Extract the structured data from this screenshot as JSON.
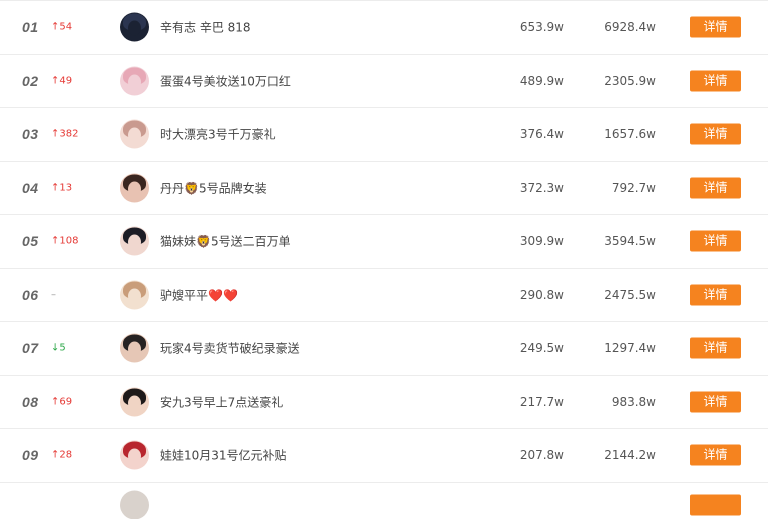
{
  "colors": {
    "accent": "#f5831f",
    "up": "#e53935",
    "down": "#2ea84a",
    "row_border": "#ececec"
  },
  "rows": [
    {
      "rank": "01",
      "trend": "↑54",
      "trend_dir": "up",
      "name": "辛有志 辛巴 818",
      "v1": "653.9w",
      "v2": "6928.4w",
      "btn": "详情",
      "avatar": [
        "#1b2233",
        "#2b3550"
      ]
    },
    {
      "rank": "02",
      "trend": "↑49",
      "trend_dir": "up",
      "name": "蛋蛋4号美妆送10万口红",
      "v1": "489.9w",
      "v2": "2305.9w",
      "btn": "详情",
      "avatar": [
        "#f1cfd6",
        "#e7a8b6"
      ]
    },
    {
      "rank": "03",
      "trend": "↑382",
      "trend_dir": "up",
      "name": "时大漂亮3号千万豪礼",
      "v1": "376.4w",
      "v2": "1657.6w",
      "btn": "详情",
      "avatar": [
        "#f3dbd3",
        "#c99a8f"
      ]
    },
    {
      "rank": "04",
      "trend": "↑13",
      "trend_dir": "up",
      "name": "丹丹🦁5号品牌女装",
      "v1": "372.3w",
      "v2": "792.7w",
      "btn": "详情",
      "avatar": [
        "#e8c2b2",
        "#3a2620"
      ]
    },
    {
      "rank": "05",
      "trend": "↑108",
      "trend_dir": "up",
      "name": "猫妹妹🦁5号送二百万单",
      "v1": "309.9w",
      "v2": "3594.5w",
      "btn": "详情",
      "avatar": [
        "#f0d7cf",
        "#1d1d26"
      ]
    },
    {
      "rank": "06",
      "trend": "–",
      "trend_dir": "none",
      "name": "驴嫂平平❤️❤️",
      "v1": "290.8w",
      "v2": "2475.5w",
      "btn": "详情",
      "avatar": [
        "#f2e0cf",
        "#c99d7a"
      ]
    },
    {
      "rank": "07",
      "trend": "↓5",
      "trend_dir": "down",
      "name": "玩家4号卖货节破纪录豪送",
      "v1": "249.5w",
      "v2": "1297.4w",
      "btn": "详情",
      "avatar": [
        "#e6c7b6",
        "#262222"
      ]
    },
    {
      "rank": "08",
      "trend": "↑69",
      "trend_dir": "up",
      "name": "安九3号早上7点送豪礼",
      "v1": "217.7w",
      "v2": "983.8w",
      "btn": "详情",
      "avatar": [
        "#f0d4c4",
        "#1e1a1a"
      ]
    },
    {
      "rank": "09",
      "trend": "↑28",
      "trend_dir": "up",
      "name": "娃娃10月31号亿元补贴",
      "v1": "207.8w",
      "v2": "2144.2w",
      "btn": "详情",
      "avatar": [
        "#f3d3cc",
        "#b8262e"
      ]
    }
  ]
}
